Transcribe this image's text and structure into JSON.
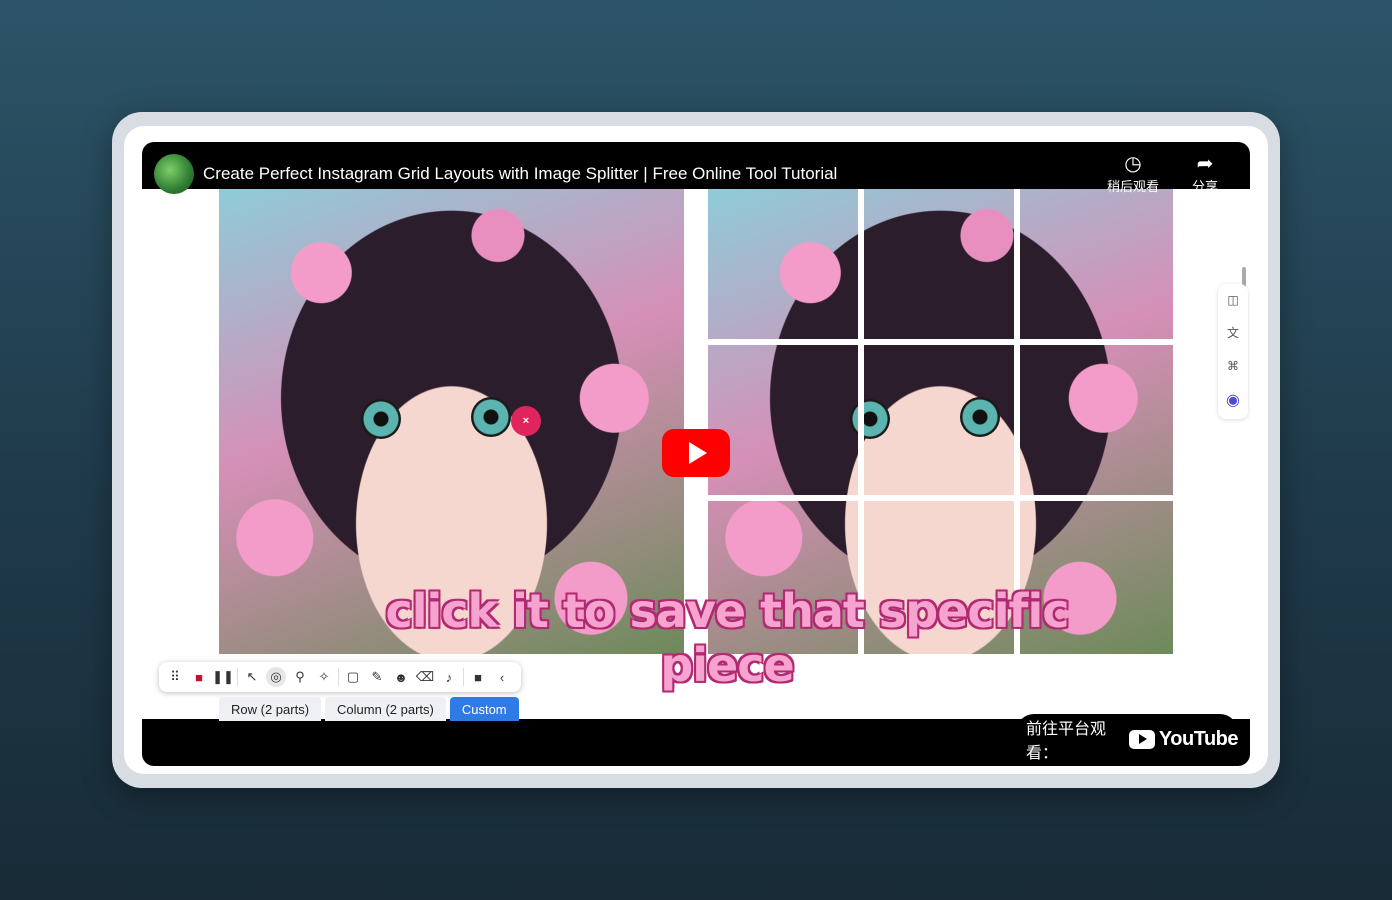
{
  "video": {
    "title": "Create Perfect Instagram Grid Layouts with Image Splitter | Free Online Tool Tutorial",
    "caption": "click it to save that specific piece",
    "watch_later_label": "稍后观看",
    "share_label": "分享",
    "watch_on_label": "前往平台观看：",
    "platform_name": "YouTube",
    "click_marker": "×"
  },
  "recorder_toolbar": {
    "tools": [
      "drag-handle-icon",
      "stop-icon",
      "pause-icon",
      "cursor-icon",
      "spotlight-icon",
      "zoom-icon",
      "effects-icon",
      "rectangle-icon",
      "magic-wand-icon",
      "emoji-icon",
      "eraser-icon",
      "mute-icon",
      "camera-icon",
      "collapse-icon"
    ]
  },
  "split_tabs": [
    {
      "label": "Row (2 parts)",
      "active": false
    },
    {
      "label": "Column (2 parts)",
      "active": false
    },
    {
      "label": "Custom",
      "active": true
    }
  ],
  "colors": {
    "play_button": "#ff0000",
    "active_tab": "#2f7ae5",
    "caption": "#f6a3cf"
  }
}
